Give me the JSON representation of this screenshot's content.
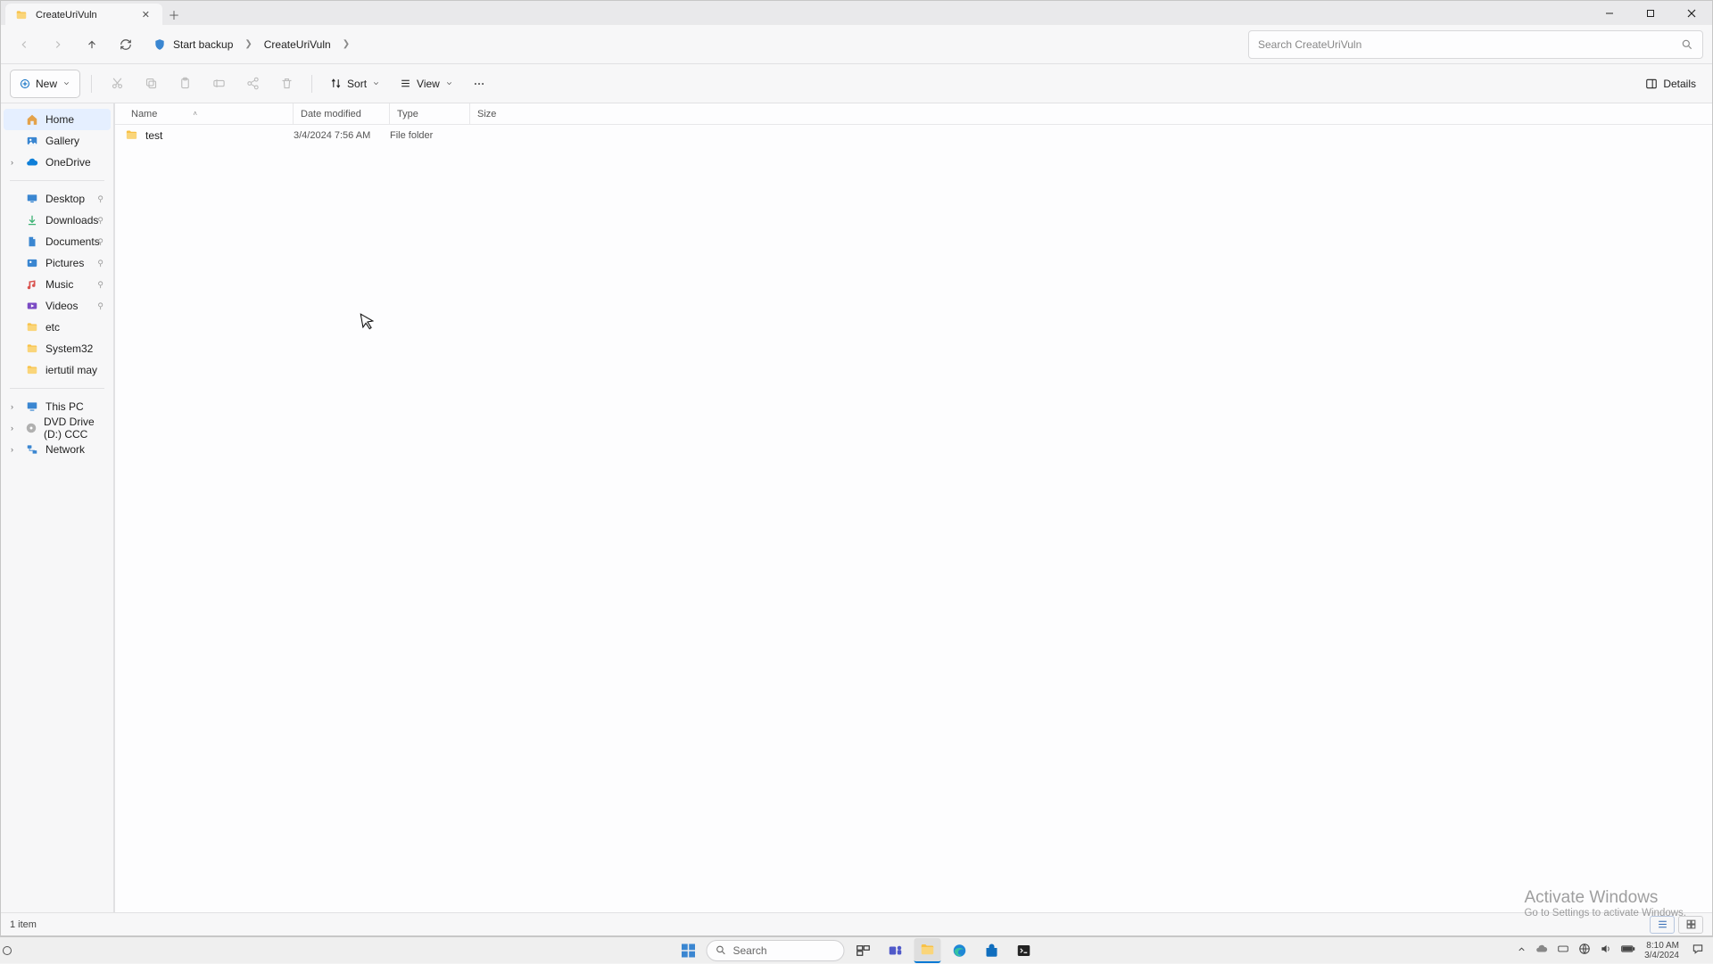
{
  "window": {
    "tab_title": "CreateUriVuln",
    "minimize": "—",
    "maximize": "▢",
    "close": "✕"
  },
  "nav": {
    "breadcrumb": [
      "Start backup",
      "CreateUriVuln"
    ],
    "search_placeholder": "Search CreateUriVuln"
  },
  "toolbar": {
    "new": "New",
    "sort": "Sort",
    "view": "View",
    "details": "Details"
  },
  "sidebar": {
    "top": [
      {
        "label": "Home",
        "selected": true
      },
      {
        "label": "Gallery"
      },
      {
        "label": "OneDrive",
        "expandable": true
      }
    ],
    "quick": [
      {
        "label": "Desktop",
        "pinned": true
      },
      {
        "label": "Downloads",
        "pinned": true
      },
      {
        "label": "Documents",
        "pinned": true
      },
      {
        "label": "Pictures",
        "pinned": true
      },
      {
        "label": "Music",
        "pinned": true
      },
      {
        "label": "Videos",
        "pinned": true
      },
      {
        "label": "etc"
      },
      {
        "label": "System32"
      },
      {
        "label": "iertutil may"
      }
    ],
    "drives": [
      {
        "label": "This PC",
        "expandable": true
      },
      {
        "label": "DVD Drive (D:) CCC",
        "expandable": true
      },
      {
        "label": "Network",
        "expandable": true
      }
    ]
  },
  "columns": {
    "name": "Name",
    "date": "Date modified",
    "type": "Type",
    "size": "Size"
  },
  "rows": [
    {
      "name": "test",
      "date": "3/4/2024 7:56 AM",
      "type": "File folder",
      "size": ""
    }
  ],
  "status": {
    "count": "1 item"
  },
  "watermark": {
    "title": "Activate Windows",
    "sub": "Go to Settings to activate Windows."
  },
  "taskbar": {
    "search": "Search",
    "time": "8:10 AM",
    "date": "3/4/2024"
  }
}
